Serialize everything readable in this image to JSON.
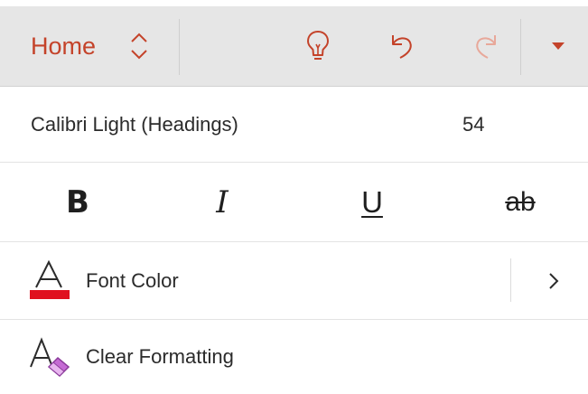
{
  "toolbar": {
    "tab_label": "Home",
    "icons": [
      "chevron-updown-icon",
      "lightbulb-icon",
      "undo-icon",
      "redo-icon",
      "dropdown-icon"
    ],
    "accent_color": "#c4432a",
    "disabled_color": "#e8a89a"
  },
  "font": {
    "name": "Calibri Light (Headings)",
    "size": "54"
  },
  "styles": {
    "bold": "B",
    "italic": "I",
    "underline": "U",
    "strikethrough": "ab"
  },
  "font_color": {
    "label": "Font Color",
    "swatch_color": "#e0101e"
  },
  "clear_formatting": {
    "label": "Clear Formatting",
    "eraser_color": "#c56bd4"
  }
}
